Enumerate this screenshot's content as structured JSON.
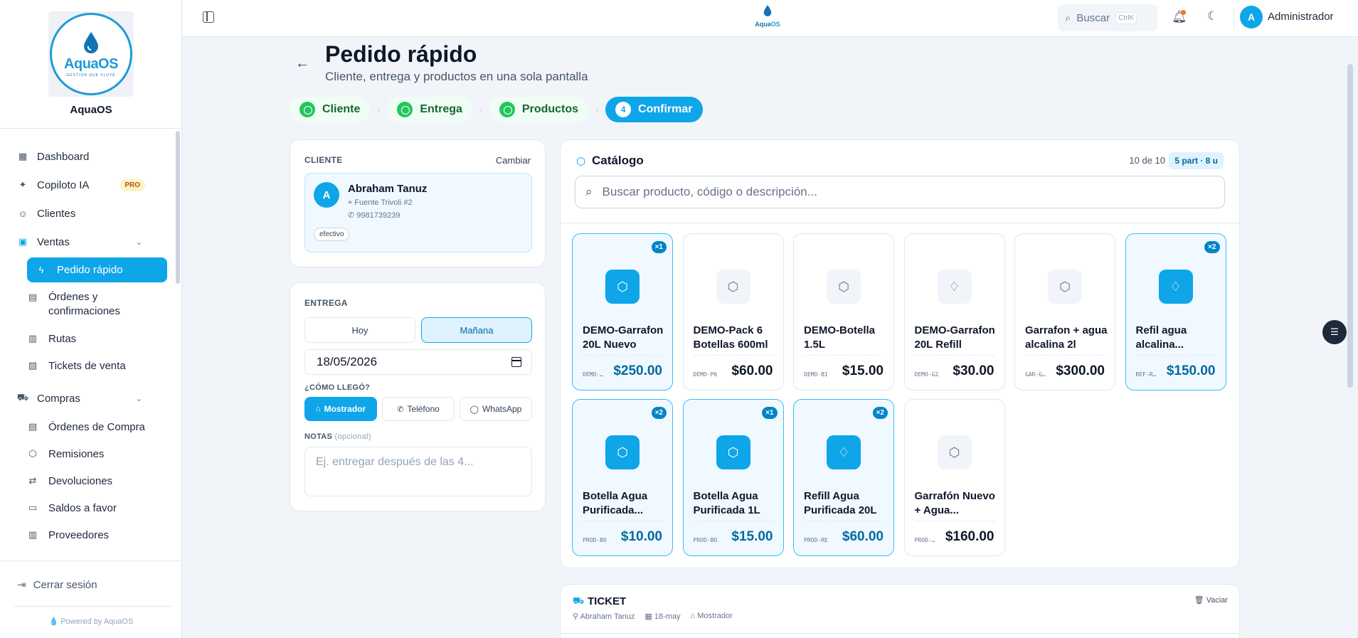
{
  "brand": {
    "logo_main": "Aqua",
    "logo_accent": "OS",
    "logo_tagline": "GESTION QUE FLUYE",
    "name": "AquaOS",
    "powered": "Powered by AquaOS"
  },
  "sidebar": {
    "items": [
      {
        "label": "Dashboard",
        "icon": "grid-icon"
      },
      {
        "label": "Copiloto IA",
        "icon": "sparkles-icon",
        "badge": "PRO"
      },
      {
        "label": "Clientes",
        "icon": "users-icon"
      },
      {
        "label": "Ventas",
        "icon": "shopping-bag-icon"
      }
    ],
    "ventas_sub": [
      {
        "label": "Pedido rápido",
        "icon": "bolt-icon",
        "active": true
      },
      {
        "label": "Órdenes y confirmaciones",
        "icon": "clipboard-icon"
      },
      {
        "label": "Rutas",
        "icon": "map-icon"
      },
      {
        "label": "Tickets de venta",
        "icon": "receipt-icon"
      }
    ],
    "compras": {
      "label": "Compras",
      "icon": "cart-icon"
    },
    "compras_sub": [
      {
        "label": "Órdenes de Compra",
        "icon": "file-icon"
      },
      {
        "label": "Remisiones",
        "icon": "box-icon"
      },
      {
        "label": "Devoluciones",
        "icon": "swap-icon"
      },
      {
        "label": "Saldos a favor",
        "icon": "wallet-icon"
      },
      {
        "label": "Proveedores",
        "icon": "building-icon"
      }
    ],
    "logout": "Cerrar sesión"
  },
  "topbar": {
    "logo_main": "Aqua",
    "logo_accent": "OS",
    "search_label": "Buscar",
    "search_kbd": "CtrlK",
    "user_initial": "A",
    "user_name": "Administrador"
  },
  "page": {
    "title": "Pedido rápido",
    "subtitle": "Cliente, entrega y productos en una sola pantalla"
  },
  "steps": [
    {
      "label": "Cliente",
      "state": "done"
    },
    {
      "label": "Entrega",
      "state": "done"
    },
    {
      "label": "Productos",
      "state": "done"
    },
    {
      "label": "Confirmar",
      "state": "current",
      "num": "4"
    }
  ],
  "cliente": {
    "heading": "CLIENTE",
    "change": "Cambiar",
    "initial": "A",
    "name": "Abraham Tanuz",
    "address": "Fuente Trivoli #2",
    "phone": "9981739239",
    "tag": "efectivo"
  },
  "entrega": {
    "heading": "ENTREGA",
    "opt_today": "Hoy",
    "opt_tomorrow": "Mañana",
    "selected": "Mañana",
    "date": "18/05/2026",
    "how_heading": "¿CÓMO LLEGÓ?",
    "channels": [
      {
        "label": "Mostrador",
        "icon": "store-icon",
        "selected": true
      },
      {
        "label": "Teléfono",
        "icon": "phone-icon",
        "selected": false
      },
      {
        "label": "WhatsApp",
        "icon": "chat-icon",
        "selected": false
      }
    ],
    "notes_heading": "NOTAS",
    "notes_optional": "(opcional)",
    "notes_placeholder": "Ej. entregar después de las 4..."
  },
  "catalogo": {
    "title": "Catálogo",
    "count": "10 de 10",
    "summary": "5 part · 8 u",
    "search_placeholder": "Buscar producto, código o descripción...",
    "products": [
      {
        "name": "DEMO-Garrafon 20L Nuevo",
        "code": "DEMO-…",
        "price": "$250.00",
        "qty": "×1",
        "icon": "box-icon",
        "selected": true
      },
      {
        "name": "DEMO-Pack 6 Botellas 600ml",
        "code": "DEMO-P6",
        "price": "$60.00",
        "qty": "",
        "icon": "box-icon",
        "selected": false
      },
      {
        "name": "DEMO-Botella 1.5L",
        "code": "DEMO-B15",
        "price": "$15.00",
        "qty": "",
        "icon": "box-icon",
        "selected": false
      },
      {
        "name": "DEMO-Garrafon 20L Refill",
        "code": "DEMO-G2…",
        "price": "$30.00",
        "qty": "",
        "icon": "droplets-icon",
        "selected": false
      },
      {
        "name": "Garrafon + agua alcalina 2l",
        "code": "GAR-G…",
        "price": "$300.00",
        "qty": "",
        "icon": "box-icon",
        "selected": false
      },
      {
        "name": "Refil agua alcalina...",
        "code": "REF-R…",
        "price": "$150.00",
        "qty": "×2",
        "icon": "droplets-icon",
        "selected": true
      },
      {
        "name": "Botella Agua Purificada...",
        "code": "PROD-BO…",
        "price": "$10.00",
        "qty": "×2",
        "icon": "box-icon",
        "selected": true
      },
      {
        "name": "Botella Agua Purificada 1L",
        "code": "PROD-BO…",
        "price": "$15.00",
        "qty": "×1",
        "icon": "box-icon",
        "selected": true
      },
      {
        "name": "Refill Agua Purificada 20L",
        "code": "PROD-RE…",
        "price": "$60.00",
        "qty": "×2",
        "icon": "droplets-icon",
        "selected": true
      },
      {
        "name": "Garrafón Nuevo + Agua...",
        "code": "PROD-…",
        "price": "$160.00",
        "qty": "",
        "icon": "box-icon",
        "selected": false
      }
    ]
  },
  "ticket": {
    "title": "TICKET",
    "clear": "Vaciar",
    "client": "Abraham Tanuz",
    "date": "18-may",
    "channel": "Mostrador"
  }
}
